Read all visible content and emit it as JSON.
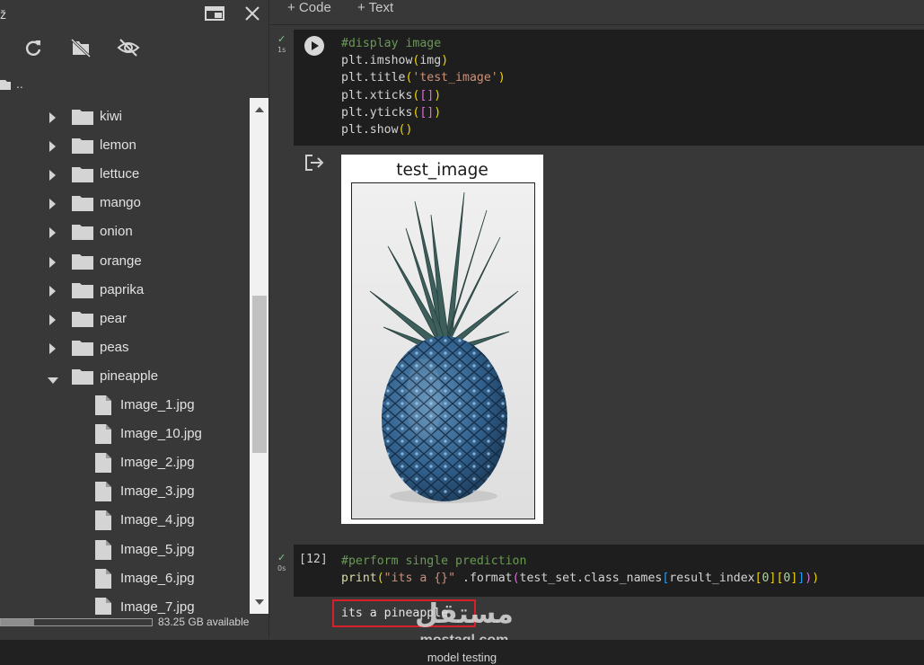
{
  "panel": {
    "parent_label": "..",
    "folders": [
      {
        "name": "kiwi",
        "expanded": false
      },
      {
        "name": "lemon",
        "expanded": false
      },
      {
        "name": "lettuce",
        "expanded": false
      },
      {
        "name": "mango",
        "expanded": false
      },
      {
        "name": "onion",
        "expanded": false
      },
      {
        "name": "orange",
        "expanded": false
      },
      {
        "name": "paprika",
        "expanded": false
      },
      {
        "name": "pear",
        "expanded": false
      },
      {
        "name": "peas",
        "expanded": false
      },
      {
        "name": "pineapple",
        "expanded": true
      }
    ],
    "files": [
      "Image_1.jpg",
      "Image_10.jpg",
      "Image_2.jpg",
      "Image_3.jpg",
      "Image_4.jpg",
      "Image_5.jpg",
      "Image_6.jpg",
      "Image_7.jpg"
    ],
    "disk_text": "83.25 GB available",
    "disk_used_fraction": 0.22,
    "icons": [
      "new-window-icon",
      "close-icon",
      "refresh-icon",
      "hide-file-icon",
      "eye-off-icon",
      "folder-icon",
      "file-icon"
    ]
  },
  "toolbar": {
    "add_code": "+ Code",
    "add_text": "+ Text"
  },
  "cell1": {
    "exec_time": "1s",
    "comment": "#display image",
    "line1_fn": "plt.imshow",
    "line1_arg": "img",
    "line2_fn": "plt.title",
    "line2_arg": "'test_image'",
    "line3_fn": "plt.xticks",
    "line4_fn": "plt.yticks",
    "line5_fn": "plt.show",
    "output_title": "test_image"
  },
  "cell2": {
    "exec_count": "[12]",
    "exec_time": "0s",
    "comment": "#perform single prediction",
    "print_fn": "print",
    "print_str": "\"its a {}\"",
    "format_call": " .format",
    "arg_obj": "test_set.class_names",
    "arg_idx": "result_index",
    "zero": "0",
    "output_text": "its a pineapple"
  },
  "watermark": {
    "arabic": "مستقل",
    "latin": "mostaql.com"
  },
  "caption": "model testing",
  "colors": {
    "background": "#383838",
    "cell_bg": "#1e1e1e",
    "comment": "#6a9955",
    "string": "#ce9178",
    "function": "#dcdcaa",
    "highlight_border": "#d8202a"
  }
}
